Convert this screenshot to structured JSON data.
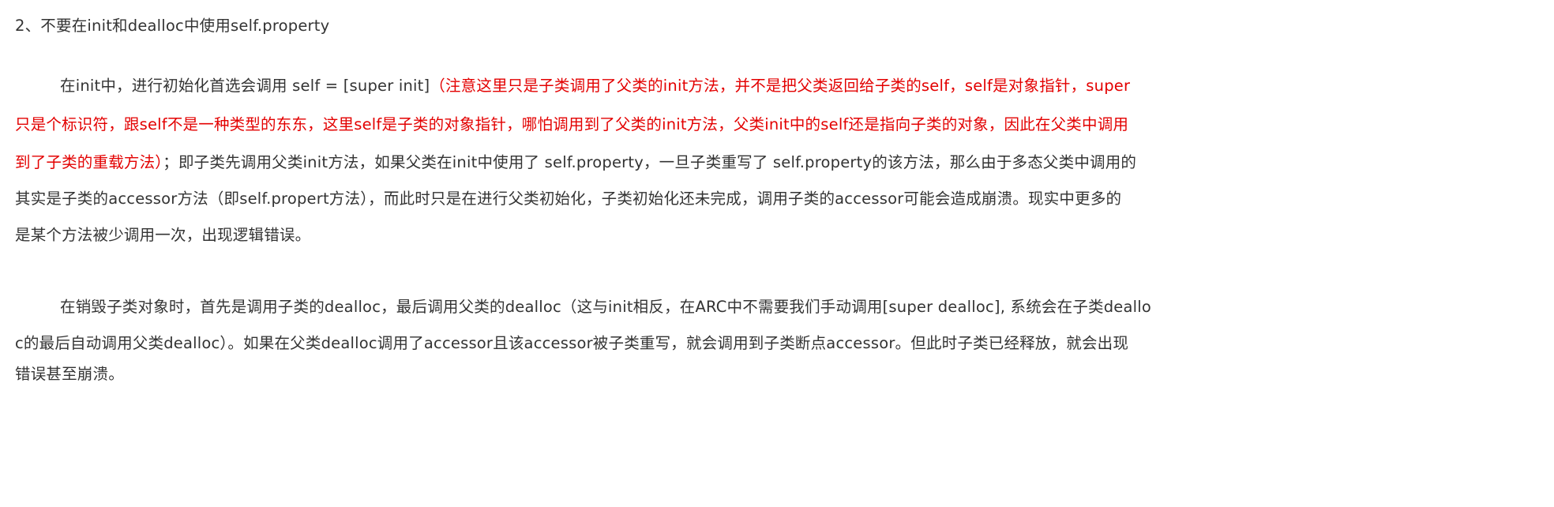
{
  "heading": "2、不要在init和dealloc中使用self.property",
  "paragraph1": {
    "lines": [
      {
        "normal": "在init中，进行初始化首选会调用   self = [super init]",
        "red": "（注意这里只是子类调用了父类的init方法，并不是把父类返回给子类的self，self是对象指针，super"
      },
      {
        "normal": "",
        "red": "只是个标识符，跟self不是一种类型的东东，这里self是子类的对象指针，哪怕调用到了父类的init方法，父类init中的self还是指向子类的对象，因此在父类中调用"
      },
      {
        "red": "到了子类的重载方法）",
        "normal": "；即子类先调用父类init方法，如果父类在init中使用了 self.property，一旦子类重写了 self.property的该方法，那么由于多态父类中调用的"
      },
      {
        "normal": "其实是子类的accessor方法（即self.propert方法），而此时只是在进行父类初始化，子类初始化还未完成，调用子类的accessor可能会造成崩溃。现实中更多的"
      },
      {
        "normal": "是某个方法被少调用一次，出现逻辑错误。"
      }
    ]
  },
  "paragraph2": {
    "lines": [
      "在销毁子类对象时，首先是调用子类的dealloc，最后调用父类的dealloc（这与init相反，在ARC中不需要我们手动调用[super dealloc], 系统会在子类deallo",
      "c的最后自动调用父类dealloc）。如果在父类dealloc调用了accessor且该accessor被子类重写，就会调用到子类断点accessor。但此时子类已经释放，就会出现",
      "错误甚至崩溃。"
    ]
  },
  "colors": {
    "text": "#333333",
    "highlight": "#e30000"
  }
}
